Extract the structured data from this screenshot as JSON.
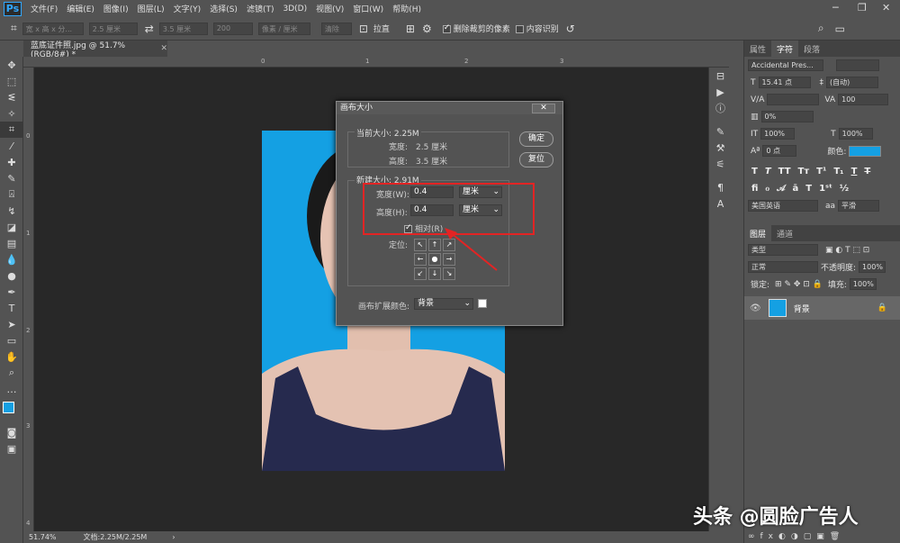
{
  "app": {
    "logo": "Ps"
  },
  "menu": [
    "文件(F)",
    "编辑(E)",
    "图像(I)",
    "图层(L)",
    "文字(Y)",
    "选择(S)",
    "滤镜(T)",
    "3D(D)",
    "视图(V)",
    "窗口(W)",
    "帮助(H)"
  ],
  "options": {
    "ratio": "宽 x 高 x 分...",
    "width": "2.5 厘米",
    "height": "3.5 厘米",
    "resolution": "200",
    "unit": "像素 / 厘米",
    "clear": "清除",
    "straighten": "拉直",
    "delete_cropped": "删除裁剪的像素",
    "content_aware": "内容识别"
  },
  "document": {
    "tab_title": "蓝底证件照.jpg @ 51.7%(RGB/8#) *",
    "zoom": "51.74%",
    "doc_info": "文档:2.25M/2.25M"
  },
  "ruler": {
    "top": [
      "0",
      "1",
      "2",
      "3"
    ],
    "left": [
      "0",
      "1",
      "2",
      "3",
      "4"
    ]
  },
  "dialog": {
    "title": "画布大小",
    "current_size": "当前大小: 2.25M",
    "cur_width_label": "宽度:",
    "cur_width": "2.5 厘米",
    "cur_height_label": "高度:",
    "cur_height": "3.5 厘米",
    "new_size": "新建大小: 2.91M",
    "width_label": "宽度(W):",
    "width_value": "0.4",
    "width_unit": "厘米",
    "height_label": "高度(H):",
    "height_value": "0.4",
    "height_unit": "厘米",
    "relative": "相对(R)",
    "anchor_label": "定位:",
    "ext_color_label": "画布扩展颜色:",
    "ext_color_value": "背景",
    "ok": "确定",
    "reset": "复位"
  },
  "char_panel": {
    "tabs": [
      "属性",
      "字符",
      "段落"
    ],
    "font": "Accidental Pres...",
    "size": "15.41 点",
    "leading": "(自动)",
    "kerning": "V/A",
    "tracking": "100",
    "scale_v": "100%",
    "scale_h": "100%",
    "baseline": "0 点",
    "color_label": "颜色:",
    "color": "#14a0e3",
    "language": "美国英语",
    "aa": "平滑",
    "pct_zero": "0%"
  },
  "layers_panel": {
    "tabs": [
      "图层",
      "通道"
    ],
    "filter": "类型",
    "blend": "正常",
    "opacity_label": "不透明度:",
    "opacity": "100%",
    "lock_label": "锁定:",
    "fill_label": "填充:",
    "fill": "100%",
    "layer_name": "背景"
  },
  "watermark": "头条 @圆脸广告人"
}
